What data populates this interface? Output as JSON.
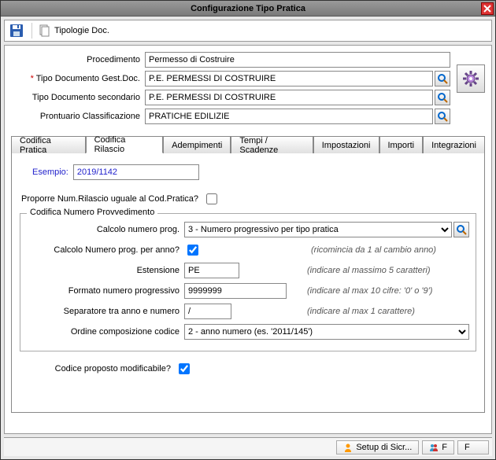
{
  "window": {
    "title": "Configurazione Tipo Pratica"
  },
  "toolbar": {
    "tipologie_doc": "Tipologie Doc."
  },
  "header": {
    "procedimento": {
      "label": "Procedimento",
      "value": "Permesso di Costruire"
    },
    "tipo_doc_gest": {
      "label": "Tipo Documento Gest.Doc.",
      "value": "P.E. PERMESSI DI COSTRUIRE",
      "required": true
    },
    "tipo_doc_sec": {
      "label": "Tipo Documento secondario",
      "value": "P.E. PERMESSI DI COSTRUIRE"
    },
    "prontuario": {
      "label": "Prontuario Classificazione",
      "value": "PRATICHE EDILIZIE"
    }
  },
  "tabs": {
    "codifica_pratica": "Codifica Pratica",
    "codifica_rilascio": "Codifica Rilascio",
    "adempimenti": "Adempimenti",
    "tempi_scadenze": "Tempi / Scadenze",
    "impostazioni": "Impostazioni",
    "importi": "Importi",
    "integrazioni": "Integrazioni"
  },
  "rilascio": {
    "esempio_label": "Esempio:",
    "esempio_value": "2019/1142",
    "proporre_label": "Proporre Num.Rilascio uguale al Cod.Pratica?",
    "proporre_checked": false,
    "fieldset_legend": "Codifica Numero Provvedimento",
    "calcolo_prog": {
      "label": "Calcolo numero prog.",
      "value": "3 - Numero progressivo per tipo pratica"
    },
    "calcolo_anno": {
      "label": "Calcolo Numero prog. per anno?",
      "checked": true,
      "hint": "(ricomincia da 1 al cambio anno)"
    },
    "estensione": {
      "label": "Estensione",
      "value": "PE",
      "hint": "(indicare al massimo 5 caratteri)"
    },
    "formato": {
      "label": "Formato numero progressivo",
      "value": "9999999",
      "hint": "(indicare al max 10 cifre: '0' o '9')"
    },
    "separatore": {
      "label": "Separatore tra anno e numero",
      "value": "/",
      "hint": "(indicare al max 1 carattere)"
    },
    "ordine": {
      "label": "Ordine composizione codice",
      "value": "2 - anno numero (es. '2011/145')"
    },
    "modificabile": {
      "label": "Codice proposto modificabile?",
      "checked": true
    }
  },
  "footer": {
    "setup": "Setup di Sicr...",
    "f1": "F",
    "f2": "F"
  }
}
